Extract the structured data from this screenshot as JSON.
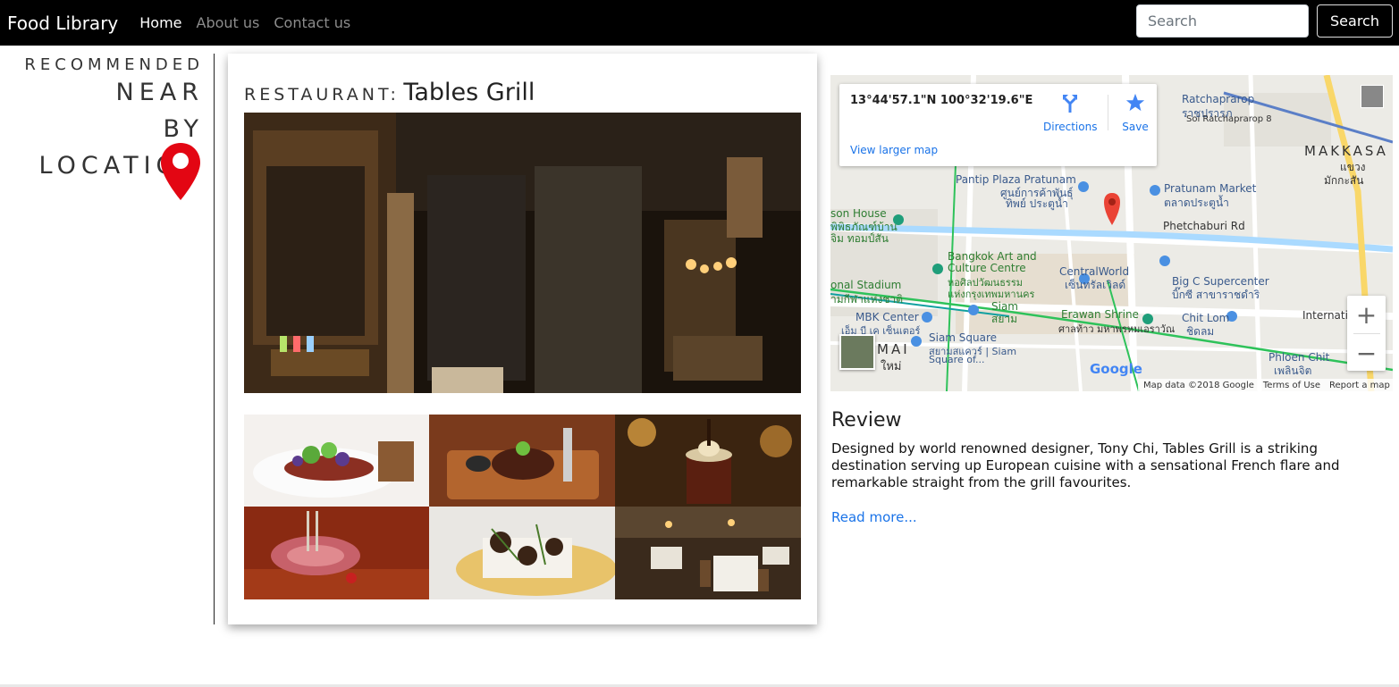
{
  "navbar": {
    "brand": "Food Library",
    "links": [
      {
        "label": "Home",
        "active": true
      },
      {
        "label": "About us",
        "active": false
      },
      {
        "label": "Contact us",
        "active": false
      }
    ],
    "search_placeholder": "Search",
    "search_button": "Search"
  },
  "sidebar": {
    "recommended": "RECOMMENDED",
    "near": "NEAR",
    "by": "BY",
    "location": "LOCATION",
    "pin_icon": "map-pin-icon",
    "pin_color": "#e30613"
  },
  "restaurant": {
    "prefix": "RESTAURANT:",
    "name": "Tables Grill",
    "hero_image": "restaurant-interior-photo",
    "thumbnails": [
      "tartare-dish-photo",
      "steak-board-photo",
      "dessert-glass-photo",
      "lamb-rack-photo",
      "fish-dish-photo",
      "dining-room-photo"
    ]
  },
  "map": {
    "coords": "13°44'57.1\"N 100°32'19.6\"E",
    "directions": "Directions",
    "save": "Save",
    "view_larger": "View larger map",
    "labels": {
      "ratchaprarop": "Ratchaprarop",
      "ratchaprarop_th": "ราชปรารภ",
      "soi": "Soi Ratchaprarop 8",
      "makkasan": "MAKKASA",
      "makkasan_th1": "แขวง",
      "makkasan_th2": "มักกะสัน",
      "pantip": "Pantip Plaza Pratunam",
      "pantip_th1": "ศูนย์การค้าพันธุ์",
      "pantip_th2": "ทิพย์ ประตูน้ำ",
      "pratunam": "Pratunam Market",
      "pratunam_th": "ตลาดประตูน้ำ",
      "jason": "son House",
      "jason_th1": "พิพิธภัณฑ์บ้าน",
      "jason_th2": "จิม ทอมป์สัน",
      "phetchaburi": "Phetchaburi Rd",
      "bacc1": "Bangkok Art and",
      "bacc2": "Culture Centre",
      "bacc_th1": "หอศิลปวัฒนธรรม",
      "bacc_th2": "แห่งกรุงเทพมหานคร",
      "central": "CentralWorld",
      "central_th": "เซ็นทรัลเวิลด์",
      "bigc": "Big C Supercenter",
      "bigc_th": "บิ๊กซี สาขาราชดำริ",
      "stadium": "onal Stadium",
      "stadium_th": "ามกีฬาแห่งชาติ",
      "siam": "Siam",
      "siam_th": "สยาม",
      "erawan": "Erawan Shrine",
      "erawan_th": "ศาลท้าว มหาพรหมเอราวัณ",
      "chitlom": "Chit Lom",
      "chitlom_th": "ชิดลม",
      "mbk": "MBK Center",
      "mbk_th": "เอ็ม บี เค เซ็นเตอร์",
      "siamsq": "Siam Square",
      "siamsq_th": "สยามสแควร์ | Siam",
      "siamsq2": "Square of...",
      "mai": "MAI",
      "mai_th": "ใหม่",
      "intl": "Internatio",
      "phloen": "Phloen Chit",
      "phloen_th": "เพลินจิต"
    },
    "zoom_in": "+",
    "zoom_out": "−",
    "google": "Google",
    "footer": {
      "data": "Map data ©2018 Google",
      "terms": "Terms of Use",
      "report": "Report a map error"
    }
  },
  "review": {
    "heading": "Review",
    "body": "Designed by world renowned designer, Tony Chi, Tables Grill is a striking destination serving up European cuisine with a sensational French flare and remarkable straight from the grill favourites.",
    "read_more": "Read more..."
  }
}
